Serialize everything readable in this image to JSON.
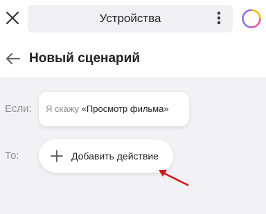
{
  "topbar": {
    "title": "Устройства",
    "close_icon": "close-icon",
    "menu_icon": "more-vertical-icon",
    "avatar_icon": "alice-avatar-icon"
  },
  "header": {
    "title": "Новый сценарий",
    "back_icon": "arrow-left-icon"
  },
  "condition": {
    "label": "Если:",
    "prefix": "Я скажу",
    "phrase": "«Просмотр фильма»"
  },
  "action": {
    "label": "То:",
    "add_label": "Добавить действие",
    "plus_icon": "plus-icon"
  },
  "annotation": {
    "arrow_color": "#d01c1c"
  },
  "colors": {
    "background": "#f2f2f4",
    "surface": "#ffffff",
    "muted_text": "#8a8a90"
  }
}
